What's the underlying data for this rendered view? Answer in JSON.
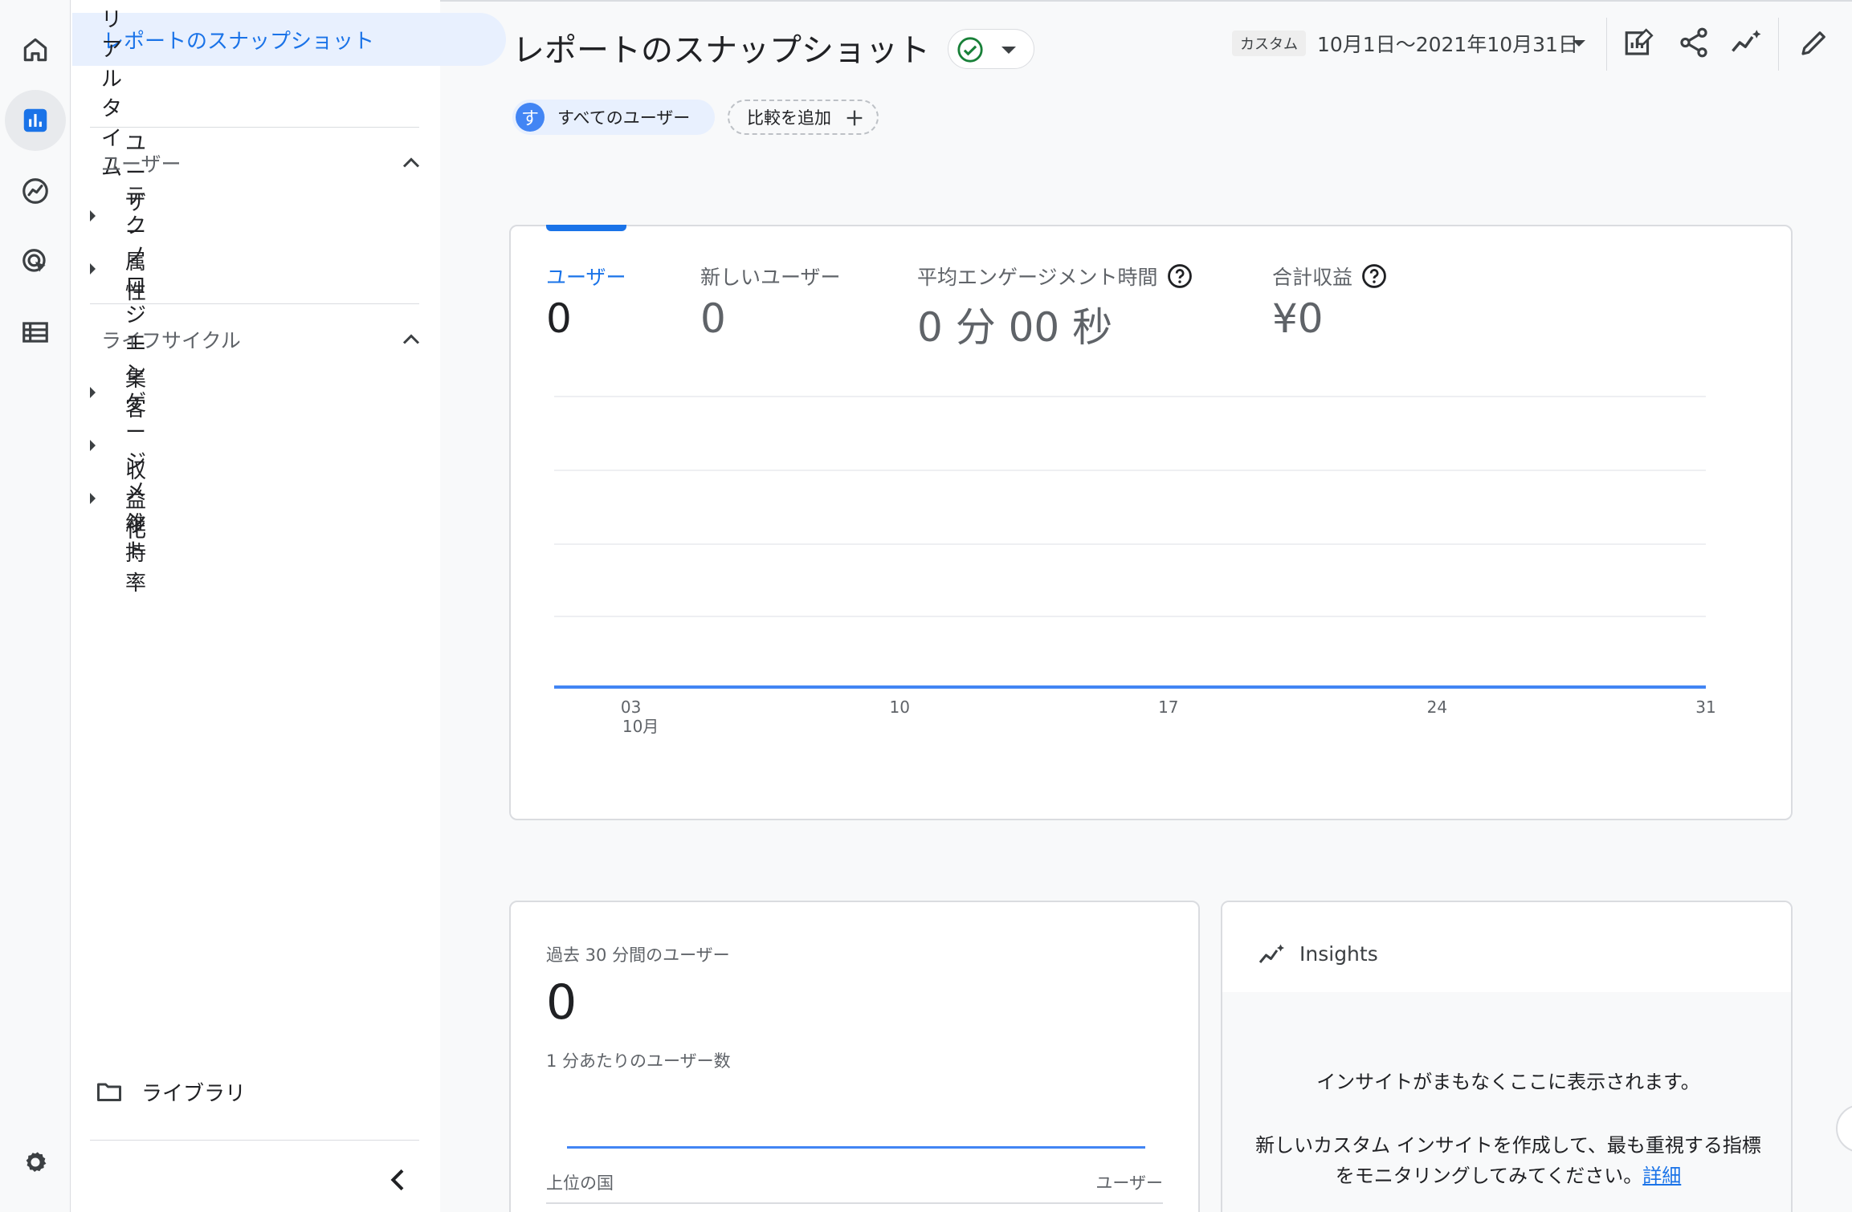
{
  "nav": {
    "selected": "レポートのスナップショット",
    "realtime": "リアルタイム",
    "section_user": "ユーザー",
    "user_attr": "ユーザー属性",
    "technology": "テクノロジー",
    "section_lifecycle": "ライフサイクル",
    "acquisition": "集客",
    "engagement": "エンゲージメント",
    "monetization": "収益化",
    "retention": "維持率",
    "library": "ライブラリ"
  },
  "header": {
    "title": "レポートのスナップショット",
    "date_badge": "カスタム",
    "date_range": "10月1日〜2021年10月31日"
  },
  "chips": {
    "avatar_letter": "す",
    "all_users": "すべてのユーザー",
    "compare": "比較を追加"
  },
  "metrics": [
    {
      "label": "ユーザー",
      "value": "0"
    },
    {
      "label": "新しいユーザー",
      "value": "0"
    },
    {
      "label": "平均エンゲージメント時間",
      "value": "0 分 00 秒"
    },
    {
      "label": "合計収益",
      "value": "¥0"
    }
  ],
  "chart_data": {
    "type": "line",
    "x_ticks": [
      "03",
      "10",
      "17",
      "24",
      "31"
    ],
    "x_sublabel": "10月",
    "x_range": [
      1,
      31
    ],
    "series": [
      {
        "values": [
          0,
          0,
          0,
          0,
          0,
          0,
          0,
          0,
          0,
          0,
          0,
          0,
          0,
          0,
          0,
          0,
          0,
          0,
          0,
          0,
          0,
          0,
          0,
          0,
          0,
          0,
          0,
          0,
          0,
          0,
          0
        ]
      }
    ],
    "grid": true,
    "color": "#4285f4"
  },
  "realtime": {
    "title": "過去 30 分間のユーザー",
    "value": "0",
    "subtitle": "1 分あたりのユーザー数",
    "col_left": "上位の国",
    "col_right": "ユーザー"
  },
  "insights": {
    "title": "Insights",
    "message": "インサイトがまもなくここに表示されます。",
    "desc": "新しいカスタム インサイトを作成して、最も重視する指標をモニタリングしてみてください。",
    "link": "詳細"
  },
  "colors": {
    "accent": "#1a73e8",
    "series": "#4285f4",
    "check": "#188038"
  }
}
